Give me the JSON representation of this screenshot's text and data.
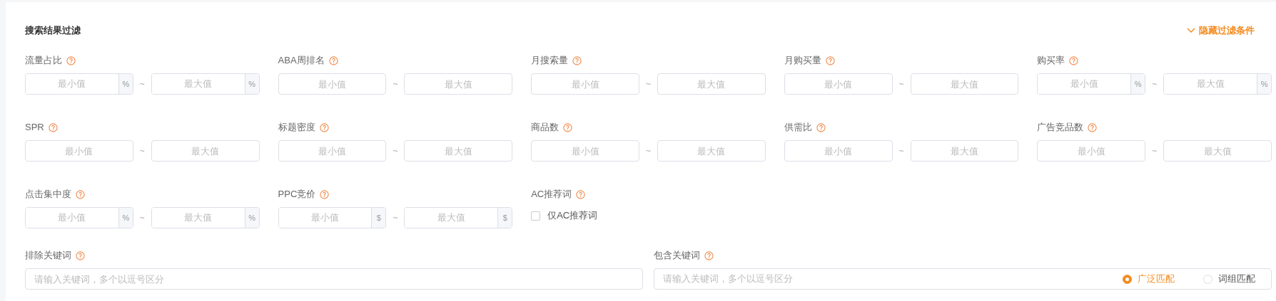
{
  "title": "搜索结果过滤",
  "toggle": {
    "label": "隐藏过滤条件"
  },
  "filter_rows": [
    [
      {
        "label": "流量占比",
        "kind": "range",
        "min_placeholder": "最小值",
        "max_placeholder": "最大值",
        "unit": "%",
        "separator": "~"
      },
      {
        "label": "ABA周排名",
        "kind": "range",
        "min_placeholder": "最小值",
        "max_placeholder": "最大值",
        "separator": "~"
      },
      {
        "label": "月搜索量",
        "kind": "range",
        "min_placeholder": "最小值",
        "max_placeholder": "最大值",
        "separator": "~"
      },
      {
        "label": "月购买量",
        "kind": "range",
        "min_placeholder": "最小值",
        "max_placeholder": "最大值",
        "separator": "~"
      },
      {
        "label": "购买率",
        "kind": "range",
        "min_placeholder": "最小值",
        "max_placeholder": "最大值",
        "unit": "%",
        "separator": "~"
      }
    ],
    [
      {
        "label": "SPR",
        "kind": "range",
        "min_placeholder": "最小值",
        "max_placeholder": "最大值",
        "separator": "~"
      },
      {
        "label": "标题密度",
        "kind": "range",
        "min_placeholder": "最小值",
        "max_placeholder": "最大值",
        "separator": "~"
      },
      {
        "label": "商品数",
        "kind": "range",
        "min_placeholder": "最小值",
        "max_placeholder": "最大值",
        "separator": "~"
      },
      {
        "label": "供需比",
        "kind": "range",
        "min_placeholder": "最小值",
        "max_placeholder": "最大值",
        "separator": "~"
      },
      {
        "label": "广告竞品数",
        "kind": "range",
        "min_placeholder": "最小值",
        "max_placeholder": "最大值",
        "separator": "~"
      }
    ],
    [
      {
        "label": "点击集中度",
        "kind": "range",
        "min_placeholder": "最小值",
        "max_placeholder": "最大值",
        "unit": "%",
        "separator": "~"
      },
      {
        "label": "PPC竞价",
        "kind": "range",
        "min_placeholder": "最小值",
        "max_placeholder": "最大值",
        "unit": "$",
        "separator": "~"
      },
      {
        "label": "AC推荐词",
        "kind": "checkbox",
        "option": "仅AC推荐词",
        "checked": false
      }
    ]
  ],
  "exclude_keywords": {
    "label": "排除关键词",
    "placeholder": "请输入关键词，多个以逗号区分"
  },
  "include_keywords": {
    "label": "包含关键词",
    "placeholder": "请输入关键词，多个以逗号区分",
    "match_options": [
      {
        "label": "广泛匹配",
        "selected": true
      },
      {
        "label": "词组匹配",
        "selected": false
      }
    ]
  }
}
